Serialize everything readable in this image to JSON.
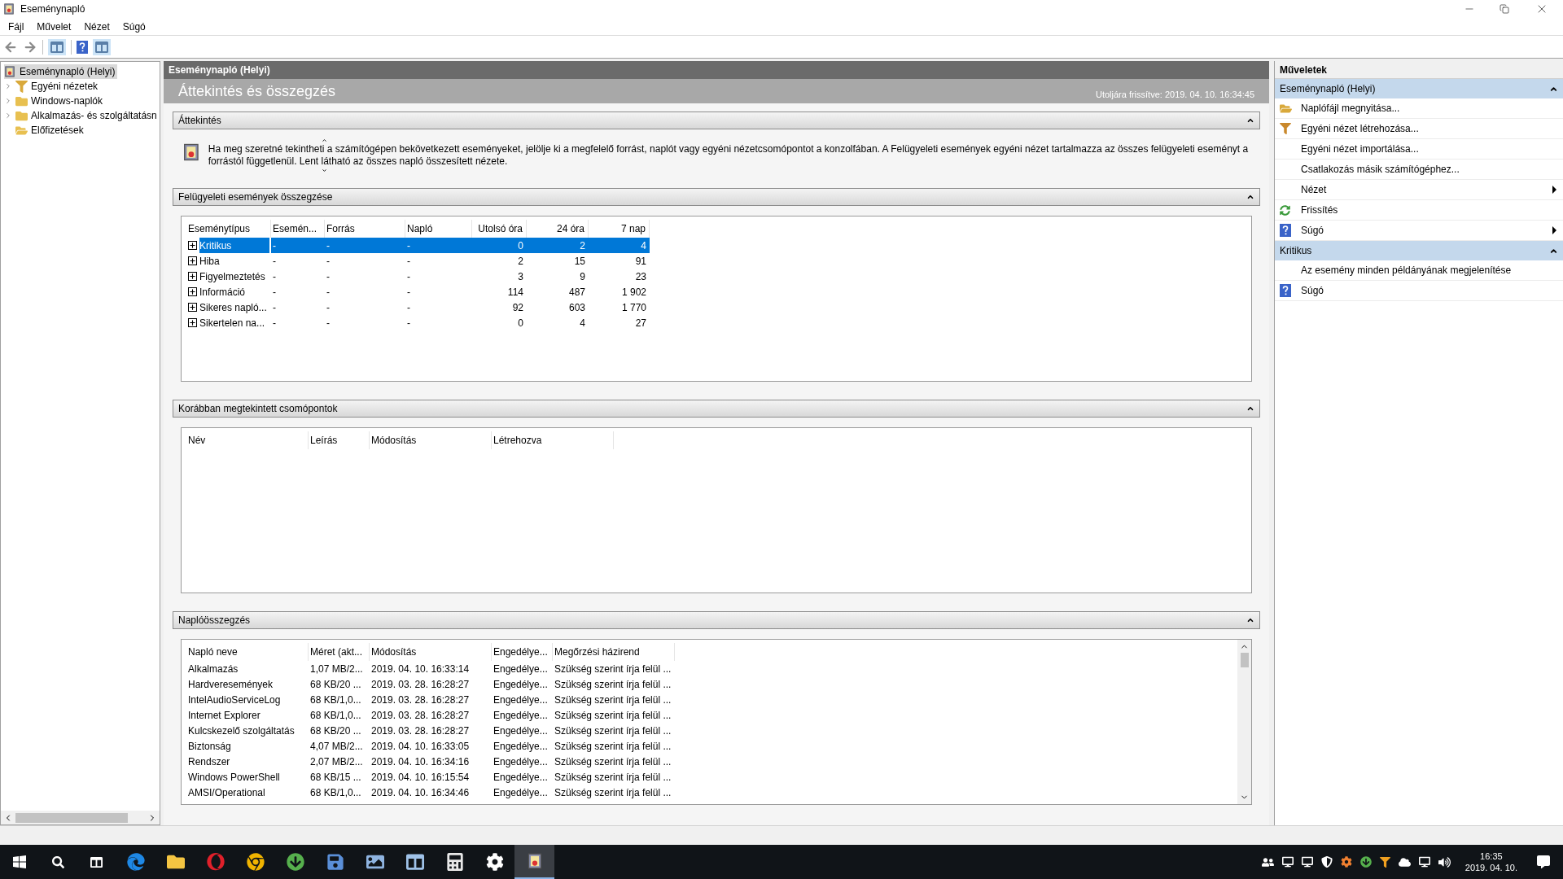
{
  "window": {
    "title": "Eseménynapló"
  },
  "menu": [
    "Fájl",
    "Művelet",
    "Nézet",
    "Súgó"
  ],
  "tree": {
    "items": [
      {
        "label": "Eseménynapló (Helyi)",
        "selected": true,
        "children": [
          {
            "label": "Egyéni nézetek",
            "selected": false,
            "expandable": true,
            "kind": "filter"
          },
          {
            "label": "Windows-naplók",
            "selected": false,
            "expandable": true,
            "kind": "logs"
          },
          {
            "label": "Alkalmazás- és szolgáltatásn",
            "selected": false,
            "expandable": true,
            "kind": "folder"
          },
          {
            "label": "Előfizetések",
            "selected": false,
            "expandable": false,
            "kind": "subscription"
          }
        ]
      }
    ]
  },
  "center": {
    "header": "Eseménynapló (Helyi)",
    "title": "Áttekintés és összegzés",
    "refreshed": "Utoljára frissítve: 2019. 04. 10. 16:34:45",
    "sections": [
      {
        "title": "Áttekintés",
        "expanded": true,
        "kind": "text",
        "text": "Ha meg szeretné tekintheti a számítógépen bekövetkezett eseményeket, jelölje ki a megfelelő forrást, naplót vagy egyéni nézetcsomópontot a konzolfában. A Felügyeleti események egyéni nézet tartalmazza az összes felügyeleti eseményt a forrástól függetlenül. Lent látható az összes napló összesített nézete."
      },
      {
        "title": "Felügyeleti események összegzése",
        "expanded": true,
        "kind": "summary",
        "columns": [
          {
            "label": "Eseménytípus",
            "kind": "text"
          },
          {
            "label": "Esemén...",
            "kind": "text"
          },
          {
            "label": "Forrás",
            "kind": "text"
          },
          {
            "label": "Napló",
            "kind": "text"
          },
          {
            "label": "Utolsó óra",
            "kind": "number"
          },
          {
            "label": "24 óra",
            "kind": "number"
          },
          {
            "label": "7 nap",
            "kind": "number"
          }
        ],
        "rows": [
          {
            "selected": true,
            "cells": [
              "Kritikus",
              "-",
              "-",
              "-",
              "0",
              "2",
              "4"
            ]
          },
          {
            "selected": false,
            "cells": [
              "Hiba",
              "-",
              "-",
              "-",
              "2",
              "15",
              "91"
            ]
          },
          {
            "selected": false,
            "cells": [
              "Figyelmeztetés",
              "-",
              "-",
              "-",
              "3",
              "9",
              "23"
            ]
          },
          {
            "selected": false,
            "cells": [
              "Információ",
              "-",
              "-",
              "-",
              "114",
              "487",
              "1 902"
            ]
          },
          {
            "selected": false,
            "cells": [
              "Sikeres napló...",
              "-",
              "-",
              "-",
              "92",
              "603",
              "1 770"
            ]
          },
          {
            "selected": false,
            "cells": [
              "Sikertelen na...",
              "-",
              "-",
              "-",
              "0",
              "4",
              "27"
            ]
          }
        ]
      },
      {
        "title": "Korábban megtekintett csomópontok",
        "expanded": true,
        "kind": "nodes",
        "columns": [
          {
            "label": "Név",
            "kind": "text"
          },
          {
            "label": "Leírás",
            "kind": "text"
          },
          {
            "label": "Módosítás",
            "kind": "text"
          },
          {
            "label": "Létrehozva",
            "kind": "text"
          }
        ]
      },
      {
        "title": "Naplóösszegzés",
        "expanded": true,
        "kind": "logs",
        "columns": [
          {
            "label": "Napló neve",
            "kind": "text"
          },
          {
            "label": "Méret (akt...",
            "kind": "text"
          },
          {
            "label": "Módosítás",
            "kind": "text"
          },
          {
            "label": "Engedélye...",
            "kind": "text"
          },
          {
            "label": "Megőrzési házirend",
            "kind": "text"
          }
        ],
        "rows": [
          {
            "cells": [
              "Alkalmazás",
              "1,07 MB/2...",
              "2019. 04. 10. 16:33:14",
              "Engedélye...",
              "Szükség szerint írja felül ..."
            ]
          },
          {
            "cells": [
              "Hardveresemények",
              "68 KB/20 ...",
              "2019. 03. 28. 16:28:27",
              "Engedélye...",
              "Szükség szerint írja felül ..."
            ]
          },
          {
            "cells": [
              "IntelAudioServiceLog",
              "68 KB/1,0...",
              "2019. 03. 28. 16:28:27",
              "Engedélye...",
              "Szükség szerint írja felül ..."
            ]
          },
          {
            "cells": [
              "Internet Explorer",
              "68 KB/1,0...",
              "2019. 03. 28. 16:28:27",
              "Engedélye...",
              "Szükség szerint írja felül ..."
            ]
          },
          {
            "cells": [
              "Kulcskezelő szolgáltatás",
              "68 KB/20 ...",
              "2019. 03. 28. 16:28:27",
              "Engedélye...",
              "Szükség szerint írja felül ..."
            ]
          },
          {
            "cells": [
              "Biztonság",
              "4,07 MB/2...",
              "2019. 04. 10. 16:33:05",
              "Engedélye...",
              "Szükség szerint írja felül ..."
            ]
          },
          {
            "cells": [
              "Rendszer",
              "2,07 MB/2...",
              "2019. 04. 10. 16:34:16",
              "Engedélye...",
              "Szükség szerint írja felül ..."
            ]
          },
          {
            "cells": [
              "Windows PowerShell",
              "68 KB/15 ...",
              "2019. 04. 10. 16:15:54",
              "Engedélye...",
              "Szükség szerint írja felül ..."
            ]
          },
          {
            "cells": [
              "AMSI/Operational",
              "68 KB/1,0...",
              "2019. 04. 10. 16:34:46",
              "Engedélye...",
              "Szükség szerint írja felül ..."
            ]
          }
        ]
      }
    ]
  },
  "actions": {
    "title": "Műveletek",
    "groups": [
      {
        "title": "Eseménynapló (Helyi)",
        "expanded": true,
        "items": [
          {
            "label": "Naplófájl megnyitása...",
            "kind": "open",
            "submenu": false
          },
          {
            "label": "Egyéni nézet létrehozása...",
            "kind": "filter",
            "submenu": false
          },
          {
            "label": "Egyéni nézet importálása...",
            "kind": "plain",
            "submenu": false
          },
          {
            "label": "Csatlakozás másik számítógéphez...",
            "kind": "plain",
            "submenu": false
          },
          {
            "label": "Nézet",
            "kind": "plain",
            "submenu": true
          },
          {
            "label": "Frissítés",
            "kind": "refresh",
            "submenu": false
          },
          {
            "label": "Súgó",
            "kind": "help",
            "submenu": true
          }
        ]
      },
      {
        "title": "Kritikus",
        "expanded": true,
        "items": [
          {
            "label": "Az esemény minden példányának megjelenítése",
            "kind": "plain",
            "submenu": false
          },
          {
            "label": "Súgó",
            "kind": "help",
            "submenu": false
          }
        ]
      }
    ]
  },
  "taskbar": {
    "apps": [
      {
        "kind": "edge",
        "selected": false
      },
      {
        "kind": "explorer",
        "selected": false
      },
      {
        "kind": "opera",
        "selected": false
      },
      {
        "kind": "chrome",
        "selected": false
      },
      {
        "kind": "torrent",
        "selected": false
      },
      {
        "kind": "save",
        "selected": false
      },
      {
        "kind": "image",
        "selected": false
      },
      {
        "kind": "window",
        "selected": false
      },
      {
        "kind": "calculator",
        "selected": false
      },
      {
        "kind": "settings",
        "selected": false
      },
      {
        "kind": "eventlog",
        "selected": true
      }
    ],
    "time": "16:35",
    "date": "2019. 04. 10."
  }
}
